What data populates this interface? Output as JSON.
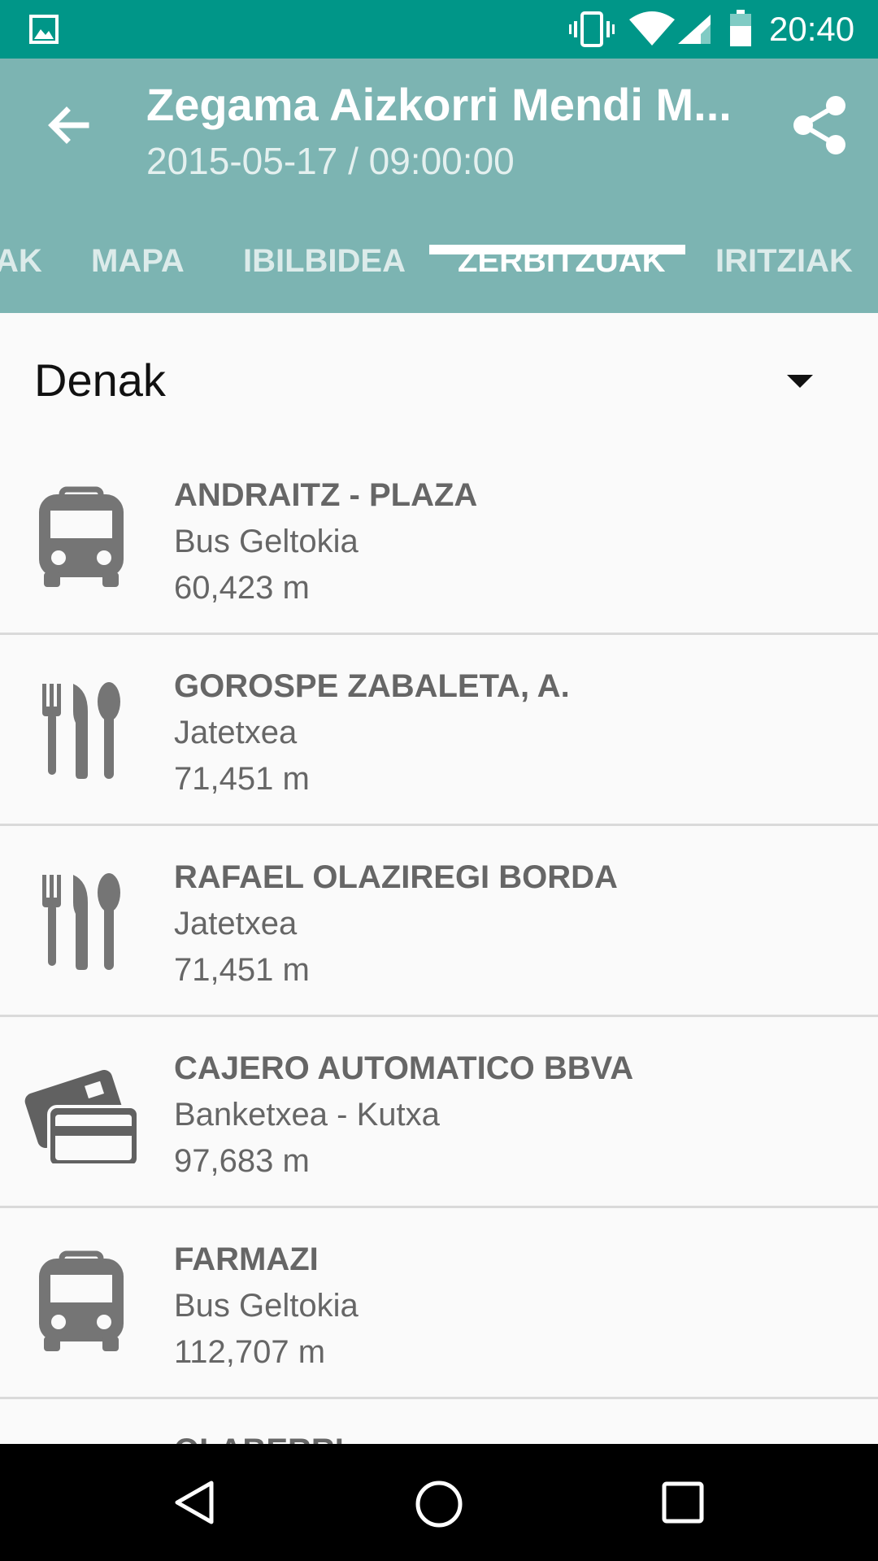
{
  "status_bar": {
    "time": "20:40",
    "icons": [
      "gallery-icon",
      "vibrate-icon",
      "wifi-icon",
      "signal-icon",
      "battery-icon"
    ]
  },
  "app_bar": {
    "title": "Zegama Aizkorri Mendi M...",
    "subtitle": "2015-05-17 / 09:00:00",
    "tabs": [
      "AK",
      "MAPA",
      "IBILBIDEA",
      "ZERBITZUAK",
      "IRITZIAK"
    ],
    "active_tab": "ZERBITZUAK"
  },
  "filter": {
    "selected": "Denak"
  },
  "services": [
    {
      "name": "ANDRAITZ - PLAZA",
      "type": "Bus Geltokia",
      "distance": "60,423 m",
      "icon": "bus-icon"
    },
    {
      "name": "GOROSPE ZABALETA, A.",
      "type": "Jatetxea",
      "distance": "71,451 m",
      "icon": "restaurant-icon"
    },
    {
      "name": "RAFAEL OLAZIREGI BORDA",
      "type": "Jatetxea",
      "distance": "71,451 m",
      "icon": "restaurant-icon"
    },
    {
      "name": "CAJERO AUTOMATICO BBVA",
      "type": "Banketxea - Kutxa",
      "distance": "97,683 m",
      "icon": "credit-card-icon"
    },
    {
      "name": "FARMAZI",
      "type": "Bus Geltokia",
      "distance": "112,707 m",
      "icon": "bus-icon"
    },
    {
      "name": "OLABERRI",
      "type": "",
      "distance": "",
      "icon": ""
    }
  ],
  "colors": {
    "status_bar": "#009688",
    "app_bar": "#7cb4b2",
    "tab_indicator": "#ffffff",
    "list_text": "#666666"
  }
}
